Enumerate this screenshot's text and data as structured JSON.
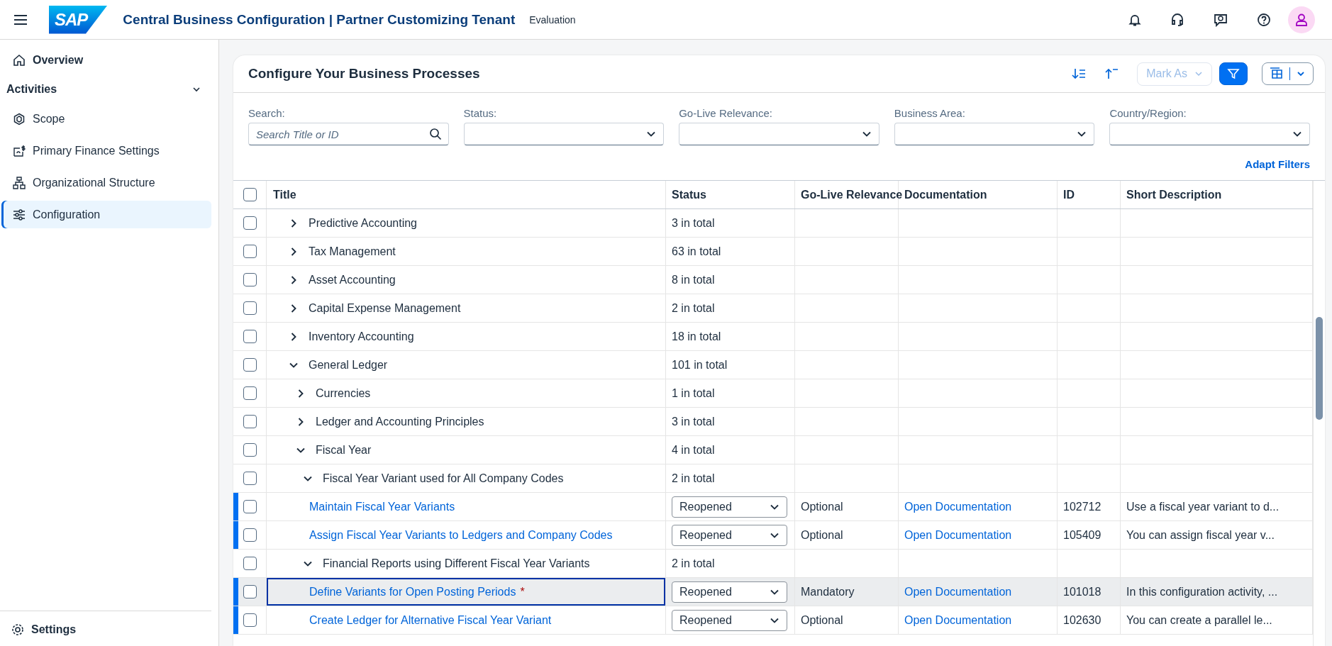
{
  "shell": {
    "logo": "SAP",
    "title": "Central Business Configuration | Partner Customizing Tenant",
    "badge": "Evaluation"
  },
  "sidebar": {
    "items": [
      {
        "label": "Overview",
        "kind": "home",
        "selected": false
      },
      {
        "label": "Activities",
        "kind": "section",
        "expanded": true,
        "children": [
          {
            "label": "Scope",
            "kind": "scope",
            "selected": false
          },
          {
            "label": "Primary Finance Settings",
            "kind": "finance",
            "selected": false
          },
          {
            "label": "Organizational Structure",
            "kind": "org",
            "selected": false
          },
          {
            "label": "Configuration",
            "kind": "config",
            "selected": true
          }
        ]
      }
    ],
    "footer": {
      "label": "Settings"
    }
  },
  "card": {
    "title": "Configure Your Business Processes",
    "toolbar": {
      "mark_as": {
        "label": "Mark As",
        "disabled": true
      },
      "filter_on": true
    },
    "filters": [
      {
        "label": "Search:",
        "kind": "search",
        "placeholder": "Search Title or ID"
      },
      {
        "label": "Status:",
        "kind": "select"
      },
      {
        "label": "Go-Live Relevance:",
        "kind": "select"
      },
      {
        "label": "Business Area:",
        "kind": "select"
      },
      {
        "label": "Country/Region:",
        "kind": "select"
      }
    ],
    "adapt_filters": "Adapt Filters",
    "table": {
      "select_all_checked": false,
      "columns": [
        "Title",
        "Status",
        "Go-Live Relevance",
        "Documentation",
        "ID",
        "Short Description"
      ],
      "rows": [
        {
          "kind": "group",
          "title": "Predictive Accounting",
          "count": "3 in total",
          "expanded": false,
          "checked": false
        },
        {
          "kind": "group",
          "title": "Tax Management",
          "count": "63 in total",
          "expanded": false,
          "checked": false
        },
        {
          "kind": "group",
          "title": "Asset Accounting",
          "count": "8 in total",
          "expanded": false,
          "checked": false
        },
        {
          "kind": "group",
          "title": "Capital Expense Management",
          "count": "2 in total",
          "expanded": false,
          "checked": false
        },
        {
          "kind": "group",
          "title": "Inventory Accounting",
          "count": "18 in total",
          "expanded": false,
          "checked": false
        },
        {
          "kind": "group",
          "title": "General Ledger",
          "count": "101 in total",
          "expanded": true,
          "checked": false,
          "children": [
            {
              "kind": "group",
              "title": "Currencies",
              "count": "1 in total",
              "expanded": false,
              "checked": false
            },
            {
              "kind": "group",
              "title": "Ledger and Accounting Principles",
              "count": "3 in total",
              "expanded": false,
              "checked": false
            },
            {
              "kind": "group",
              "title": "Fiscal Year",
              "count": "4 in total",
              "expanded": true,
              "checked": false,
              "children": [
                {
                  "kind": "group",
                  "title": "Fiscal Year Variant used for All Company Codes",
                  "count": "2 in total",
                  "expanded": true,
                  "checked": false,
                  "children": [
                    {
                      "kind": "activity",
                      "title": "Maintain Fiscal Year Variants",
                      "status": "Reopened",
                      "relevance": "Optional",
                      "documentation": "Open Documentation",
                      "id": "102712",
                      "description": "Use a fiscal year variant to d...",
                      "checked": false,
                      "focused": false
                    },
                    {
                      "kind": "activity",
                      "title": "Assign Fiscal Year Variants to Ledgers and Company Codes",
                      "status": "Reopened",
                      "relevance": "Optional",
                      "documentation": "Open Documentation",
                      "id": "105409",
                      "description": "You can assign fiscal year v...",
                      "checked": false,
                      "focused": false
                    }
                  ]
                },
                {
                  "kind": "group",
                  "title": "Financial Reports using Different Fiscal Year Variants",
                  "count": "2 in total",
                  "expanded": true,
                  "checked": false,
                  "children": [
                    {
                      "kind": "activity",
                      "title": "Define Variants for Open Posting Periods",
                      "required_mark": "*",
                      "status": "Reopened",
                      "relevance": "Mandatory",
                      "documentation": "Open Documentation",
                      "id": "101018",
                      "description": "In this configuration activity, ...",
                      "checked": false,
                      "focused": true
                    },
                    {
                      "kind": "activity",
                      "title": "Create Ledger for Alternative Fiscal Year Variant",
                      "status": "Reopened",
                      "relevance": "Optional",
                      "documentation": "Open Documentation",
                      "id": "102630",
                      "description": "You can create a parallel le...",
                      "checked": false,
                      "focused": false
                    }
                  ]
                }
              ]
            }
          ]
        }
      ]
    }
  }
}
